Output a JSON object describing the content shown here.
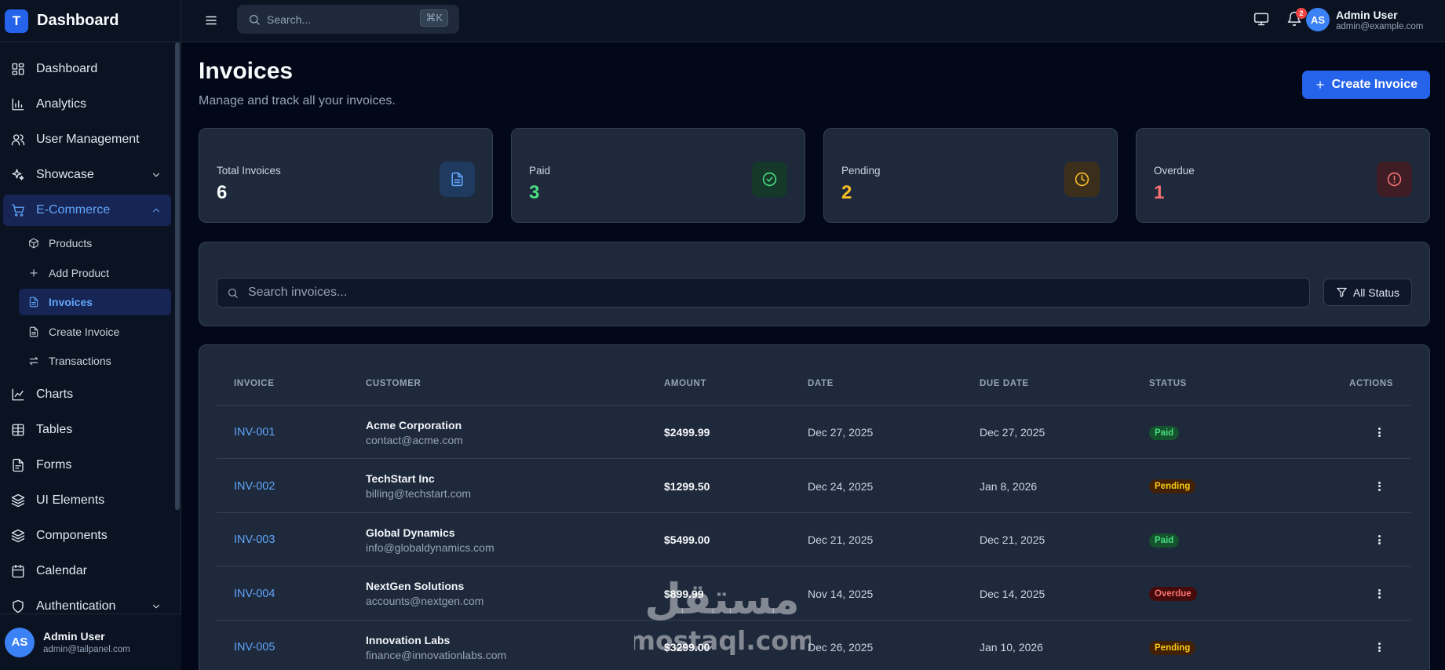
{
  "brand": {
    "logo_letter": "T",
    "title": "Dashboard",
    "color": "#2563eb"
  },
  "sidebar": {
    "items": [
      {
        "label": "Dashboard",
        "icon": "grid-icon"
      },
      {
        "label": "Analytics",
        "icon": "bar-chart-icon"
      },
      {
        "label": "User Management",
        "icon": "users-icon"
      },
      {
        "label": "Showcase",
        "icon": "sparkles-icon",
        "expandable": true
      },
      {
        "label": "E-Commerce",
        "icon": "cart-icon",
        "expandable": true,
        "expanded": true,
        "active": true
      },
      {
        "label": "Charts",
        "icon": "line-chart-icon"
      },
      {
        "label": "Tables",
        "icon": "table-icon"
      },
      {
        "label": "Forms",
        "icon": "form-icon"
      },
      {
        "label": "UI Elements",
        "icon": "layers-icon"
      },
      {
        "label": "Components",
        "icon": "layers-icon"
      },
      {
        "label": "Calendar",
        "icon": "calendar-icon"
      },
      {
        "label": "Authentication",
        "icon": "shield-icon",
        "expandable": true
      }
    ],
    "ecommerce_sub": [
      {
        "label": "Products",
        "icon": "box-icon"
      },
      {
        "label": "Add Product",
        "icon": "plus-icon"
      },
      {
        "label": "Invoices",
        "icon": "file-icon",
        "active": true
      },
      {
        "label": "Create Invoice",
        "icon": "file-icon"
      },
      {
        "label": "Transactions",
        "icon": "transfer-icon"
      }
    ],
    "user": {
      "initials": "AS",
      "name": "Admin User",
      "email": "admin@tailpanel.com"
    }
  },
  "topbar": {
    "search_placeholder": "Search...",
    "shortcut": "⌘K",
    "notification_count": "2",
    "user": {
      "initials": "AS",
      "name": "Admin User",
      "email": "admin@example.com"
    }
  },
  "page": {
    "title": "Invoices",
    "subtitle": "Manage and track all your invoices.",
    "create_button": "Create Invoice"
  },
  "stats": [
    {
      "label": "Total Invoices",
      "value": "6",
      "icon": "file-icon",
      "color": "#f8fafc",
      "icon_color": "#60a5fa",
      "icon_bg": "#1e3a5f"
    },
    {
      "label": "Paid",
      "value": "3",
      "icon": "check-circle-icon",
      "color": "#4ade80",
      "icon_color": "#4ade80",
      "icon_bg": "#14392a"
    },
    {
      "label": "Pending",
      "value": "2",
      "icon": "clock-icon",
      "color": "#fbbf24",
      "icon_color": "#fbbf24",
      "icon_bg": "#3b2f1b"
    },
    {
      "label": "Overdue",
      "value": "1",
      "icon": "alert-circle-icon",
      "color": "#f87171",
      "icon_color": "#f87171",
      "icon_bg": "#3f1d25"
    }
  ],
  "filters": {
    "search_placeholder": "Search invoices...",
    "status_label": "All Status"
  },
  "table": {
    "headers": [
      "INVOICE",
      "CUSTOMER",
      "AMOUNT",
      "DATE",
      "DUE DATE",
      "STATUS",
      "ACTIONS"
    ],
    "rows": [
      {
        "id": "INV-001",
        "customer": "Acme Corporation",
        "email": "contact@acme.com",
        "amount": "$2499.99",
        "date": "Dec 27, 2025",
        "due": "Dec 27, 2025",
        "status": "Paid"
      },
      {
        "id": "INV-002",
        "customer": "TechStart Inc",
        "email": "billing@techstart.com",
        "amount": "$1299.50",
        "date": "Dec 24, 2025",
        "due": "Jan 8, 2026",
        "status": "Pending"
      },
      {
        "id": "INV-003",
        "customer": "Global Dynamics",
        "email": "info@globaldynamics.com",
        "amount": "$5499.00",
        "date": "Dec 21, 2025",
        "due": "Dec 21, 2025",
        "status": "Paid"
      },
      {
        "id": "INV-004",
        "customer": "NextGen Solutions",
        "email": "accounts@nextgen.com",
        "amount": "$899.99",
        "date": "Nov 14, 2025",
        "due": "Dec 14, 2025",
        "status": "Overdue"
      },
      {
        "id": "INV-005",
        "customer": "Innovation Labs",
        "email": "finance@innovationlabs.com",
        "amount": "$3299.00",
        "date": "Dec 26, 2025",
        "due": "Jan 10, 2026",
        "status": "Pending"
      }
    ]
  },
  "watermark": {
    "text_arabic": "مستقل",
    "text_latin": "mostaql.com"
  }
}
